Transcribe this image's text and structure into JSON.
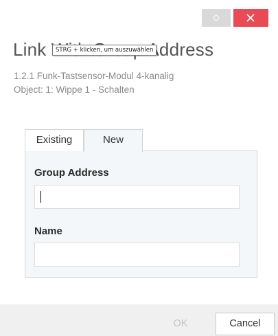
{
  "window": {
    "minimize_icon": "circle-icon",
    "close_icon": "close-icon",
    "close_color": "#e84a56"
  },
  "dialog": {
    "title": "Link With Group Address",
    "tooltip": "STRG + klicken, um auszuwählen",
    "device": "1.2.1 Funk-Tastsensor-Modul 4-kanalig",
    "object": "Object: 1: Wippe 1 - Schalten"
  },
  "tabs": [
    {
      "label": "Existing",
      "selected": false
    },
    {
      "label": "New",
      "selected": true
    }
  ],
  "form": {
    "group_address_label": "Group Address",
    "group_address_value": "",
    "name_label": "Name",
    "name_value": ""
  },
  "footer": {
    "ok_label": "OK",
    "ok_enabled": false,
    "cancel_label": "Cancel"
  }
}
